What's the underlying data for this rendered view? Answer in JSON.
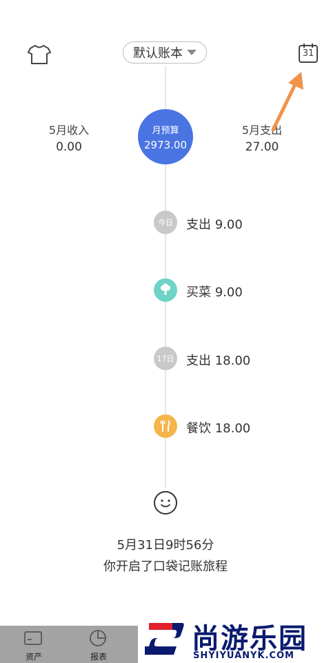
{
  "header": {
    "ledger_name": "默认账本",
    "calendar_day": "31"
  },
  "summary": {
    "income_label": "5月收入",
    "income_value": "0.00",
    "budget_label": "月预算",
    "budget_value": "2973.00",
    "expense_label": "5月支出",
    "expense_value": "27.00"
  },
  "timeline": [
    {
      "badge": "今日",
      "text": "支出 9.00",
      "color": "#c9c9c9",
      "icon": "today-badge"
    },
    {
      "badge": "",
      "text": "买菜 9.00",
      "color": "#6fd3c7",
      "icon": "vegetable-icon"
    },
    {
      "badge": "17日",
      "text": "支出 18.00",
      "color": "#c9c9c9",
      "icon": "date-badge"
    },
    {
      "badge": "",
      "text": "餐饮 18.00",
      "color": "#f5b54a",
      "icon": "fork-knife-icon"
    }
  ],
  "start": {
    "time": "5月31日9时56分",
    "message": "你开启了口袋记账旅程"
  },
  "tabs": [
    {
      "label": "资产",
      "icon": "card-icon"
    },
    {
      "label": "报表",
      "icon": "pie-chart-icon"
    }
  ],
  "watermark": {
    "title": "尚游乐园",
    "subtitle": "SHYIYUANYK.COM"
  },
  "colors": {
    "budget": "#4a74e2",
    "arrow": "#f0924a",
    "watermark": "#0a1a6e",
    "watermark_accent": "#e0202a"
  }
}
